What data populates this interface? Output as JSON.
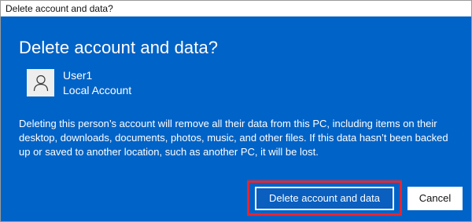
{
  "window": {
    "title": "Delete account and data?"
  },
  "dialog": {
    "heading": "Delete account and data?",
    "user": {
      "name": "User1",
      "type": "Local Account",
      "avatar_icon": "person-icon"
    },
    "message": "Deleting this person’s account will remove all their data from this PC, including items on their desktop, downloads, documents, photos, music, and other files. If this data hasn’t been backed up or saved to another location, such as another PC, it will be lost.",
    "buttons": {
      "delete_label": "Delete account and data",
      "cancel_label": "Cancel"
    }
  },
  "colors": {
    "dialog_background": "#0063c7",
    "highlight_border": "#e8252e",
    "title_bar_background": "#ffffff"
  }
}
